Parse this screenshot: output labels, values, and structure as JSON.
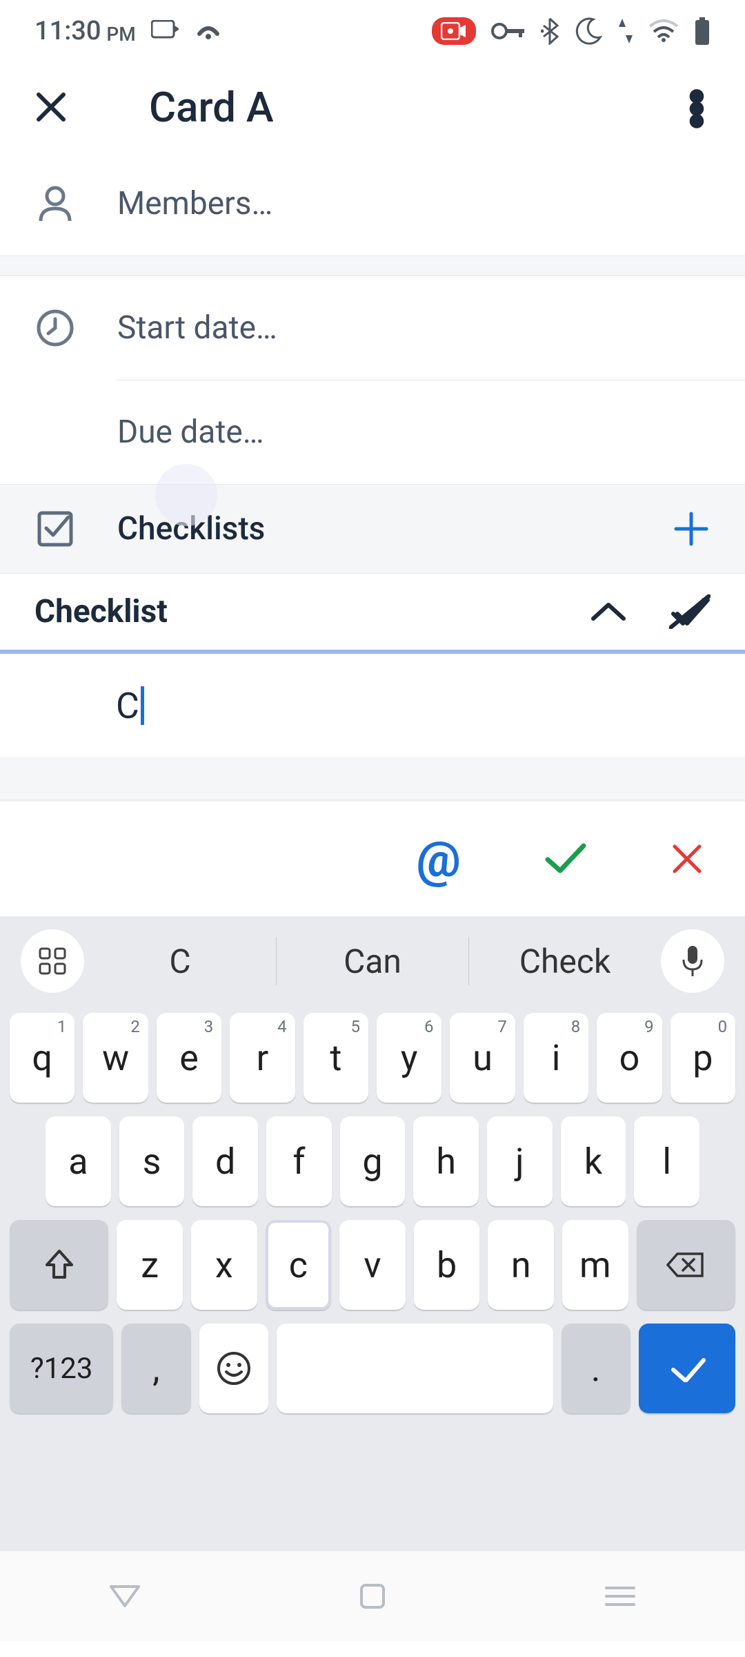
{
  "status_bar": {
    "time": "11:30",
    "period": "PM"
  },
  "header": {
    "title": "Card A"
  },
  "fields": {
    "members": "Members…",
    "start_date": "Start date…",
    "due_date": "Due date…"
  },
  "checklists": {
    "header": "Checklists",
    "title": "Checklist",
    "input_value": "C"
  },
  "keyboard": {
    "suggestions": [
      "C",
      "Can",
      "Check"
    ],
    "row1": [
      {
        "k": "q",
        "n": "1"
      },
      {
        "k": "w",
        "n": "2"
      },
      {
        "k": "e",
        "n": "3"
      },
      {
        "k": "r",
        "n": "4"
      },
      {
        "k": "t",
        "n": "5"
      },
      {
        "k": "y",
        "n": "6"
      },
      {
        "k": "u",
        "n": "7"
      },
      {
        "k": "i",
        "n": "8"
      },
      {
        "k": "o",
        "n": "9"
      },
      {
        "k": "p",
        "n": "0"
      }
    ],
    "row2": [
      "a",
      "s",
      "d",
      "f",
      "g",
      "h",
      "j",
      "k",
      "l"
    ],
    "row3": [
      "z",
      "x",
      "c",
      "v",
      "b",
      "n",
      "m"
    ],
    "symbols_key": "?123",
    "comma": ",",
    "period": "."
  }
}
